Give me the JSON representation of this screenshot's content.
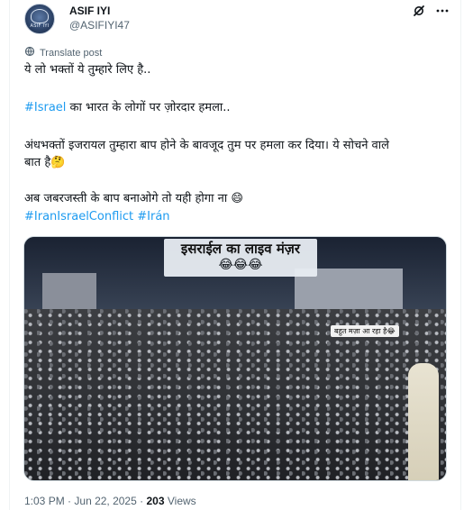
{
  "author": {
    "name": "ASIF IYI",
    "handle": "@ASIFIYI47",
    "avatar_text": "ASIF IYI"
  },
  "actions": {
    "grok_icon": "grok-icon",
    "more_icon": "more-icon"
  },
  "translate": {
    "label": "Translate post",
    "icon": "translate-icon"
  },
  "post": {
    "line1": "ये लो भक्तों ये तुम्हारे लिए है..",
    "line2_tag": "#Israel",
    "line2_rest": " का भारत के लोगों पर ज़ोरदार हमला..",
    "line3a": "अंधभक्तों इजरायल तुम्हारा बाप होने के बावजूद तुम पर हमला कर दिया। ये सोचने वाले",
    "line3b": "बात है🤔",
    "line4": "अब जबरजस्ती के बाप बनाओगे तो यही होगा ना 😄",
    "tag1": "#IranIsraelConflict",
    "tag2": "#Irán"
  },
  "media": {
    "banner_title": "इसराईल का लाइव मंज़र",
    "banner_emoji": "😂😂😂",
    "caption": "बहुत मज़ा आ रहा है😂"
  },
  "meta": {
    "time": "1:03 PM",
    "date": "Jun 22, 2025",
    "views_count": "203",
    "views_label": "Views",
    "sep": "·"
  },
  "colors": {
    "link": "#1d9bf0",
    "secondary_text": "#536471",
    "primary_text": "#0f1419"
  }
}
